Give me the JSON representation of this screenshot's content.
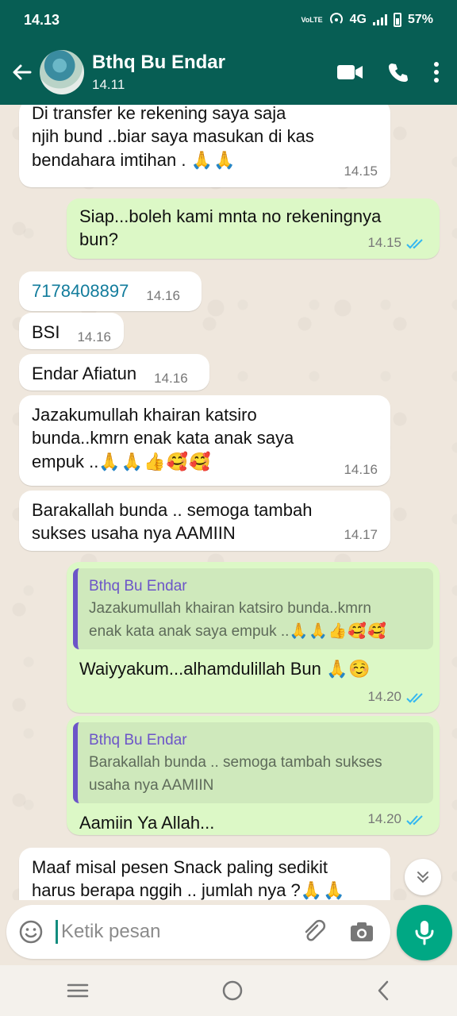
{
  "status_bar": {
    "time": "14.13",
    "network_label": "4G",
    "volte_label": "VoLTE",
    "battery": "57%"
  },
  "header": {
    "contact_name": "Bthq Bu Endar",
    "subtitle": "14.11"
  },
  "messages": [
    {
      "dir": "in",
      "text_lines": [
        "Di transfer ke rekening saya saja",
        "njih bund ..biar saya masukan di kas",
        "bendahara imtihan ."
      ],
      "emoji": "🙏🙏",
      "time": "14.15"
    },
    {
      "dir": "out",
      "text_lines": [
        "Siap...boleh kami mnta no rekeningnya",
        "bun?"
      ],
      "time": "14.15"
    },
    {
      "dir": "in",
      "text": "7178408897",
      "time": "14.16"
    },
    {
      "dir": "in",
      "text": "BSI",
      "time": "14.16"
    },
    {
      "dir": "in",
      "text": "Endar Afiatun",
      "time": "14.16"
    },
    {
      "dir": "in",
      "text_lines": [
        "Jazakumullah khairan katsiro",
        "bunda..kmrn enak kata anak saya",
        "empuk .."
      ],
      "emoji": "🙏🙏👍🥰🥰",
      "time": "14.16"
    },
    {
      "dir": "in",
      "text_lines": [
        "Barakallah bunda .. semoga tambah",
        "sukses usaha nya AAMIIN"
      ],
      "time": "14.17"
    },
    {
      "dir": "out",
      "quote": {
        "author": "Bthq Bu Endar",
        "text_lines": [
          "Jazakumullah khairan katsiro bunda..kmrn",
          "enak kata anak saya empuk .."
        ],
        "emoji": "🙏🙏👍🥰🥰"
      },
      "text": "Waiyyakum...alhamdulillah Bun",
      "emoji": "🙏☺️",
      "time": "14.20"
    },
    {
      "dir": "out",
      "quote": {
        "author": "Bthq Bu Endar",
        "text_lines": [
          "Barakallah bunda .. semoga tambah sukses",
          "usaha nya AAMIIN"
        ]
      },
      "text": "Aamiin Ya Allah...",
      "time": "14.20"
    },
    {
      "dir": "in",
      "text_lines": [
        "Maaf misal pesen Snack paling sedikit",
        "harus berapa nggih .. jumlah nya ?"
      ],
      "emoji": "🙏🙏"
    }
  ],
  "composer": {
    "placeholder": "Ketik pesan"
  },
  "icons": {
    "back": "arrow-left-icon",
    "video": "video-call-icon",
    "call": "phone-icon",
    "menu": "more-vert-icon",
    "emoji": "emoji-icon",
    "attach": "paperclip-icon",
    "camera": "camera-icon",
    "mic": "microphone-icon",
    "scroll": "chevrons-down-icon",
    "read": "double-check-icon"
  },
  "colors": {
    "header": "#075e54",
    "outgoing": "#dcf8c6",
    "incoming": "#ffffff",
    "read_ticks": "#34b7f1",
    "quote_author": "#6c55c8",
    "mic_button": "#00a884",
    "wallpaper": "#efe7dd"
  }
}
